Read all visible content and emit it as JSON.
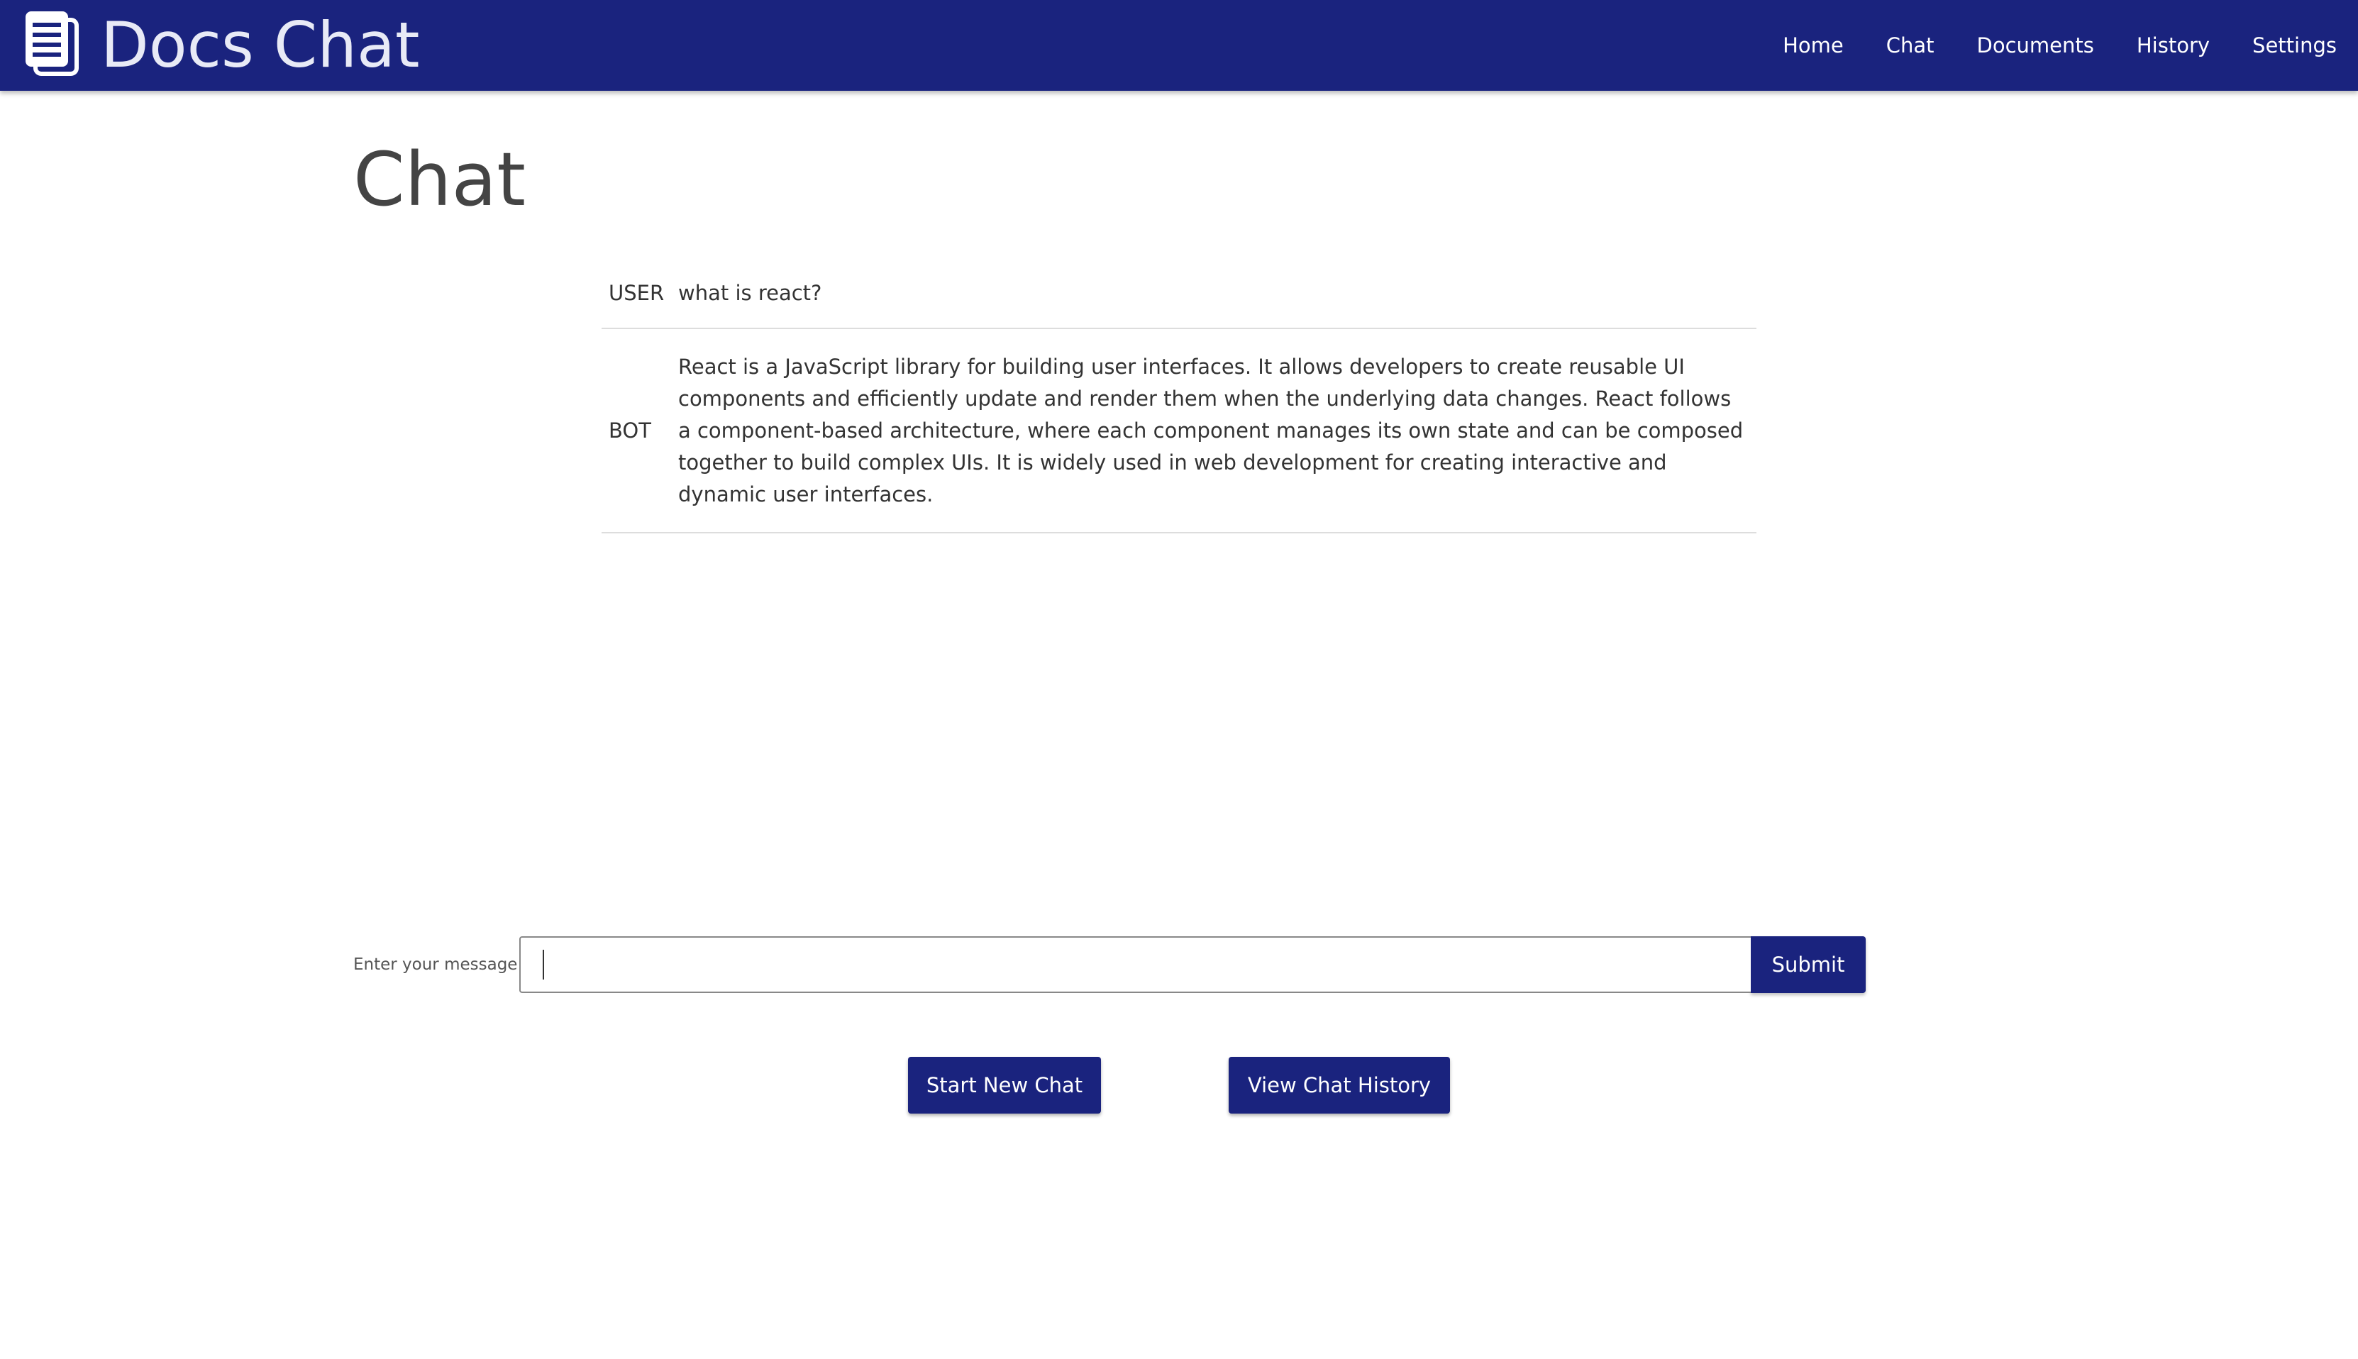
{
  "header": {
    "brand_icon": "document-icon",
    "brand_title": "Docs Chat",
    "nav": [
      "Home",
      "Chat",
      "Documents",
      "History",
      "Settings"
    ]
  },
  "page": {
    "title": "Chat"
  },
  "conversation": [
    {
      "role": "USER",
      "text": "what is react?"
    },
    {
      "role": "BOT",
      "text": "React is a JavaScript library for building user interfaces. It allows developers to create reusable UI components and efficiently update and render them when the underlying data changes. React follows a component-based architecture, where each component manages its own state and can be composed together to build complex UIs. It is widely used in web development for creating interactive and dynamic user interfaces."
    }
  ],
  "composer": {
    "label": "Enter your message:",
    "value": "",
    "submit_label": "Submit"
  },
  "actions": {
    "new_chat_label": "Start New Chat",
    "view_history_label": "View Chat History"
  },
  "colors": {
    "navbar": "#1a237e",
    "button": "#1a237e",
    "brand_text": "#e8eaf6"
  }
}
